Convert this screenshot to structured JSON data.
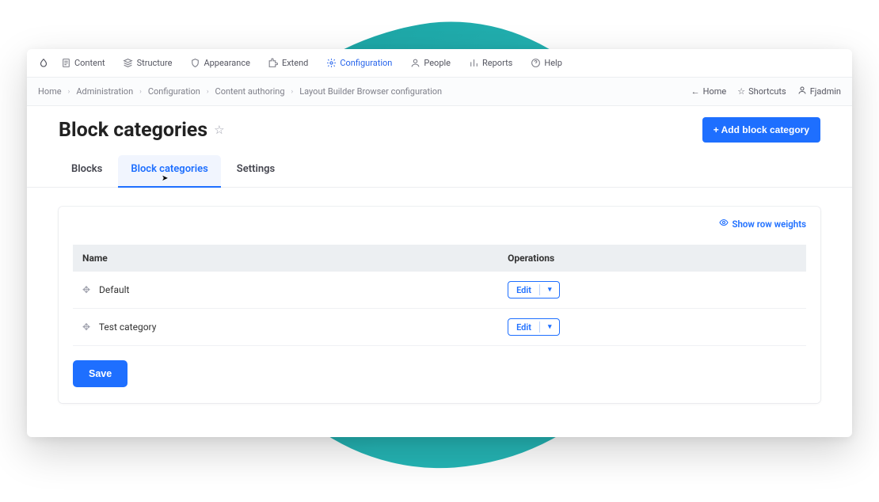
{
  "toolbar": [
    {
      "name": "content",
      "label": "Content",
      "icon": "document-icon",
      "active": false
    },
    {
      "name": "structure",
      "label": "Structure",
      "icon": "stack-icon",
      "active": false
    },
    {
      "name": "appearance",
      "label": "Appearance",
      "icon": "shield-icon",
      "active": false
    },
    {
      "name": "extend",
      "label": "Extend",
      "icon": "puzzle-icon",
      "active": false
    },
    {
      "name": "configuration",
      "label": "Configuration",
      "icon": "gear-icon",
      "active": true
    },
    {
      "name": "people",
      "label": "People",
      "icon": "person-icon",
      "active": false
    },
    {
      "name": "reports",
      "label": "Reports",
      "icon": "bar-chart-icon",
      "active": false
    },
    {
      "name": "help",
      "label": "Help",
      "icon": "help-icon",
      "active": false
    }
  ],
  "breadcrumb": [
    "Home",
    "Administration",
    "Configuration",
    "Content authoring",
    "Layout Builder Browser configuration"
  ],
  "secondary_nav": {
    "home": "Home",
    "shortcuts": "Shortcuts",
    "user": "Fjadmin"
  },
  "page_title": "Block categories",
  "add_button": "+ Add block category",
  "tabs": [
    {
      "name": "blocks",
      "label": "Blocks",
      "active": false
    },
    {
      "name": "block-categories",
      "label": "Block categories",
      "active": true
    },
    {
      "name": "settings",
      "label": "Settings",
      "active": false
    }
  ],
  "show_row_weights": "Show row weights",
  "table": {
    "head_name": "Name",
    "head_ops": "Operations",
    "rows": [
      {
        "name": "Default",
        "op": "Edit"
      },
      {
        "name": "Test category",
        "op": "Edit"
      }
    ]
  },
  "save": "Save"
}
